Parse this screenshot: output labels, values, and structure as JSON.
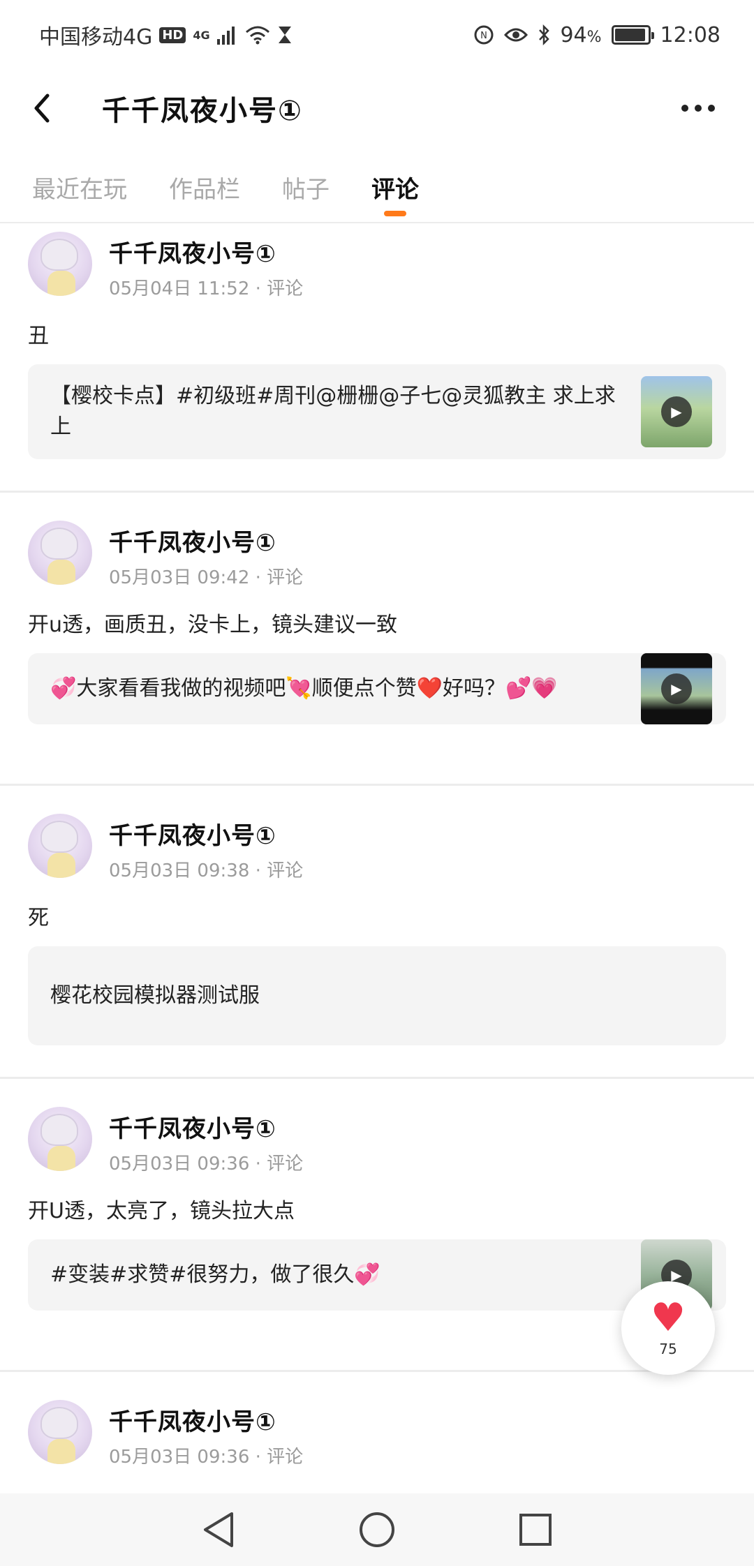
{
  "status_bar": {
    "carrier": "中国移动4G",
    "hd_badge": "HD",
    "network": "4G",
    "battery_text": "94",
    "battery_percent_sign": "%",
    "battery_level": 0.94,
    "time": "12:08"
  },
  "header": {
    "title": "千千凤夜小号①"
  },
  "tabs": [
    {
      "label": "最近在玩",
      "active": false
    },
    {
      "label": "作品栏",
      "active": false
    },
    {
      "label": "帖子",
      "active": false
    },
    {
      "label": "评论",
      "active": true
    }
  ],
  "posts": [
    {
      "name": "千千凤夜小号①",
      "time": "05月04日 11:52 · 评论",
      "text": "丑",
      "quote": "【樱校卡点】#初级班#周刊@栅栅@子七@灵狐教主 求上求上",
      "has_thumb": true
    },
    {
      "name": "千千凤夜小号①",
      "time": "05月03日 09:42 · 评论",
      "text": "开u透，画质丑，没卡上，镜头建议一致",
      "quote": "💞大家看看我做的视频吧💘顺便点个赞❤️好吗？💕💗",
      "has_thumb": true
    },
    {
      "name": "千千凤夜小号①",
      "time": "05月03日 09:38 · 评论",
      "text": "死",
      "quote": "樱花校园模拟器测试服",
      "has_thumb": false
    },
    {
      "name": "千千凤夜小号①",
      "time": "05月03日 09:36 · 评论",
      "text": "开U透，太亮了，镜头拉大点",
      "quote": "#变装#求赞#很努力，做了很久💞",
      "has_thumb": true
    },
    {
      "name": "千千凤夜小号①",
      "time": "05月03日 09:36 · 评论",
      "text": "",
      "quote": "",
      "has_thumb": false
    }
  ],
  "like_fab": {
    "count": "75",
    "icon": "heart-icon"
  },
  "nav": {
    "back_icon": "triangle-back-icon",
    "home_icon": "circle-home-icon",
    "recents_icon": "square-recents-icon"
  }
}
